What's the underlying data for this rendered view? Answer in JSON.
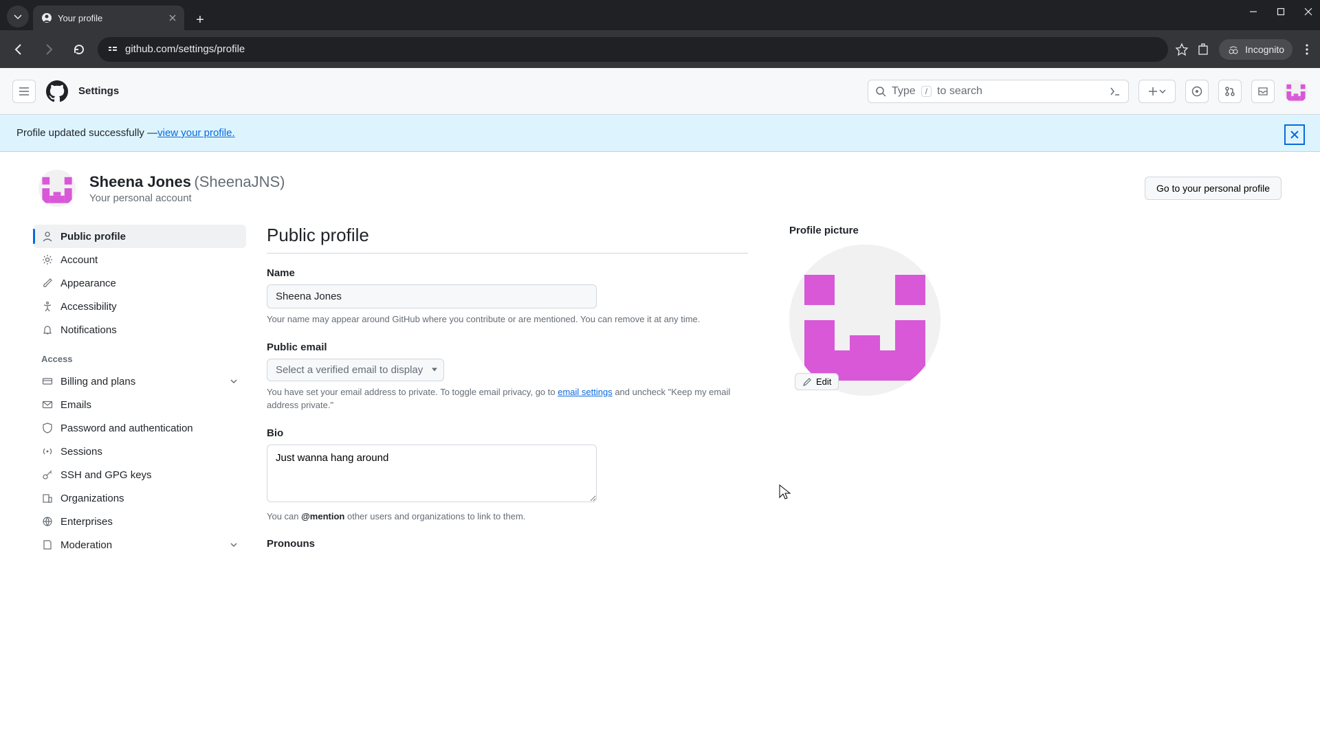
{
  "browser": {
    "tab_title": "Your profile",
    "url": "github.com/settings/profile",
    "incognito_label": "Incognito"
  },
  "header": {
    "app_title": "Settings",
    "search_prefix": "Type",
    "search_key": "/",
    "search_suffix": "to search"
  },
  "flash": {
    "message": "Profile updated successfully — ",
    "link_text": "view your profile."
  },
  "account": {
    "display_name": "Sheena Jones",
    "login": "(SheenaJNS)",
    "subtitle": "Your personal account",
    "go_profile_btn": "Go to your personal profile"
  },
  "sidebar": {
    "items_top": [
      "Public profile",
      "Account",
      "Appearance",
      "Accessibility",
      "Notifications"
    ],
    "group_access_label": "Access",
    "items_access": [
      "Billing and plans",
      "Emails",
      "Password and authentication",
      "Sessions",
      "SSH and GPG keys",
      "Organizations",
      "Enterprises",
      "Moderation"
    ]
  },
  "form": {
    "section_title": "Public profile",
    "name_label": "Name",
    "name_value": "Sheena Jones",
    "name_help": "Your name may appear around GitHub where you contribute or are mentioned. You can remove it at any time.",
    "email_label": "Public email",
    "email_placeholder": "Select a verified email to display",
    "email_help_pre": "You have set your email address to private. To toggle email privacy, go to ",
    "email_help_link": "email settings",
    "email_help_post": " and uncheck \"Keep my email address private.\"",
    "bio_label": "Bio",
    "bio_value": "Just wanna hang around",
    "bio_help_pre": "You can ",
    "bio_help_mention": "@mention",
    "bio_help_post": " other users and organizations to link to them.",
    "pronouns_label": "Pronouns"
  },
  "picture": {
    "label": "Profile picture",
    "edit_label": "Edit"
  },
  "colors": {
    "identicon": "#d858d8"
  }
}
